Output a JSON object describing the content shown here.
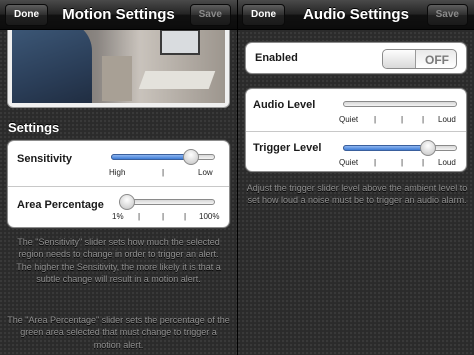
{
  "motion": {
    "title": "Motion Settings",
    "done_label": "Done",
    "save_label": "Save",
    "section_title": "Settings",
    "sensitivity": {
      "label": "Sensitivity",
      "value": 0.76,
      "min_label": "High",
      "mid_label": "|",
      "max_label": "Low"
    },
    "area": {
      "label": "Area Percentage",
      "value": 0.0,
      "min_label": "1%",
      "mid_labels": [
        "|",
        "|",
        "|"
      ],
      "max_label": "100%"
    },
    "help_sensitivity": "The \"Sensitivity\" slider sets how much the selected region needs to change in order to trigger an alert. The higher the Sensitivity, the more likely it is that a subtle change will result in a motion alert.",
    "help_area": "The \"Area Percentage\" slider sets the percentage of the green area selected that must change to trigger a motion alert."
  },
  "audio": {
    "title": "Audio Settings",
    "done_label": "Done",
    "save_label": "Save",
    "enabled_label": "Enabled",
    "toggle_label": "OFF",
    "audio_level": {
      "label": "Audio Level",
      "value": 0.0,
      "min_label": "Quiet",
      "mid_labels": [
        "|",
        "|",
        "|"
      ],
      "max_label": "Loud"
    },
    "trigger_level": {
      "label": "Trigger Level",
      "value": 0.74,
      "min_label": "Quiet",
      "mid_labels": [
        "|",
        "|",
        "|"
      ],
      "max_label": "Loud"
    },
    "help": "Adjust the trigger slider level above the ambient level to set how loud a noise must be to trigger an audio alarm."
  },
  "colors": {
    "slider_fill": "#3e7cd6",
    "nav_bar": "#111111",
    "background": "#2b2b2b"
  }
}
